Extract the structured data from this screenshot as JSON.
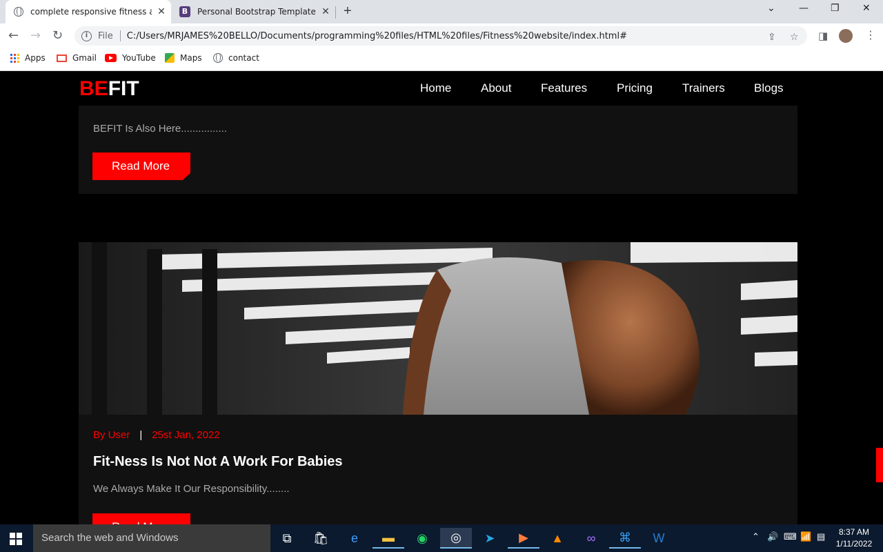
{
  "browser": {
    "tabs": [
      {
        "title": "complete responsive fitness and",
        "close": "✕"
      },
      {
        "title": "Personal Bootstrap Template",
        "close": "✕"
      }
    ],
    "new_tab": "+",
    "address": {
      "file_label": "File",
      "url": "C:/Users/MRJAMES%20BELLO/Documents/programming%20files/HTML%20files/Fitness%20website/index.html#"
    },
    "bookmarks": [
      "Apps",
      "Gmail",
      "YouTube",
      "Maps",
      "contact"
    ]
  },
  "site": {
    "logo_be": "BE",
    "logo_fit": "FIT",
    "nav": [
      "Home",
      "About",
      "Features",
      "Pricing",
      "Trainers",
      "Blogs"
    ]
  },
  "posts": [
    {
      "excerpt": "BEFIT Is Also Here................",
      "button": "Read More"
    },
    {
      "author": "By User",
      "separator": "|",
      "date": "25st Jan, 2022",
      "title": "Fit-Ness Is Not Not A Work For Babies",
      "excerpt": "We Always Make It Our Responsibility........",
      "button": "Read More"
    }
  ],
  "taskbar": {
    "search_placeholder": "Search the web and Windows",
    "time": "8:37 AM",
    "date": "1/11/2022"
  },
  "colors": {
    "accent": "#ff0000",
    "card_bg": "#111111",
    "page_bg": "#000000"
  }
}
